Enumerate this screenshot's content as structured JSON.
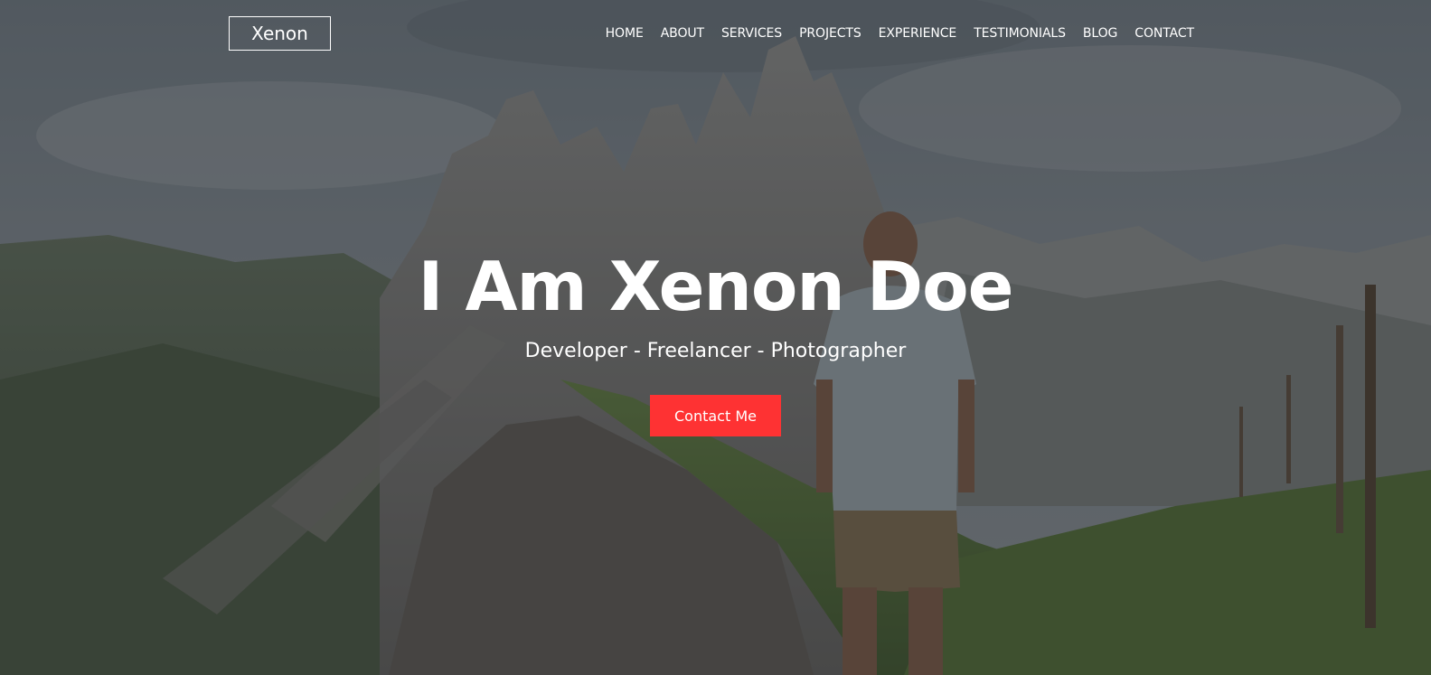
{
  "site": {
    "logo_text": "Xenon"
  },
  "nav": {
    "items": [
      {
        "label": "HOME"
      },
      {
        "label": "ABOUT"
      },
      {
        "label": "SERVICES"
      },
      {
        "label": "PROJECTS"
      },
      {
        "label": "EXPERIENCE"
      },
      {
        "label": "TESTIMONIALS"
      },
      {
        "label": "BLOG"
      },
      {
        "label": "CONTACT"
      }
    ]
  },
  "hero": {
    "title": "I Am Xenon Doe",
    "subtitle": "Developer - Freelancer - Photographer",
    "cta_label": "Contact Me",
    "background_image": "mountain-landscape-hiker"
  },
  "colors": {
    "accent": "#fe3233",
    "text": "#ffffff",
    "overlay": "#14161a"
  }
}
